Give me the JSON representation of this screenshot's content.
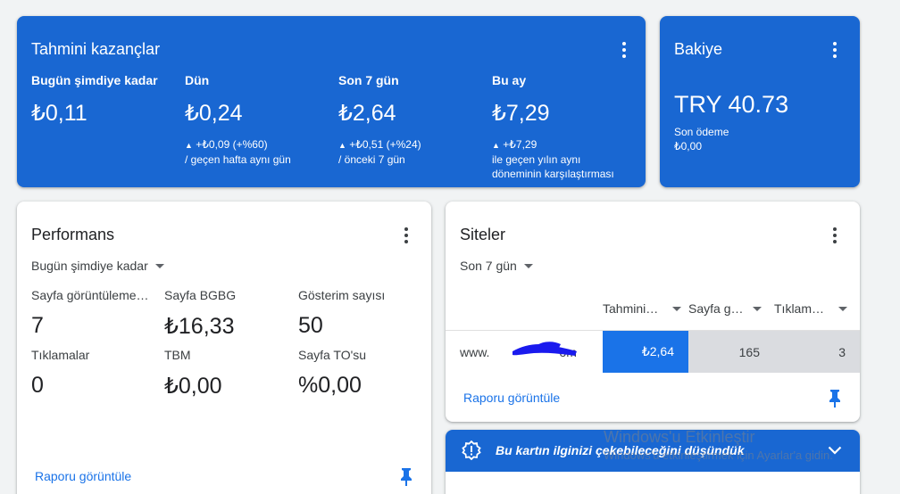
{
  "earnings": {
    "title": "Tahmini kazançlar",
    "metrics": [
      {
        "label": "Bugün şimdiye kadar",
        "value": "₺0,11",
        "delta": "",
        "delta_note": ""
      },
      {
        "label": "Dün",
        "value": "₺0,24",
        "delta": "+₺0,09 (+%60)",
        "delta_note": "/ geçen hafta aynı gün"
      },
      {
        "label": "Son 7 gün",
        "value": "₺2,64",
        "delta": "+₺0,51 (+%24)",
        "delta_note": "/ önceki 7 gün"
      },
      {
        "label": "Bu ay",
        "value": "₺7,29",
        "delta": "+₺7,29",
        "delta_note": "ile geçen yılın aynı",
        "delta_note2": "döneminin karşılaştırması"
      }
    ]
  },
  "balance": {
    "title": "Bakiye",
    "amount": "TRY 40.73",
    "last_label": "Son ödeme",
    "last_value": "₺0,00"
  },
  "performance": {
    "title": "Performans",
    "range": "Bugün şimdiye kadar",
    "stats": [
      {
        "label": "Sayfa görüntüleme…",
        "value": "7"
      },
      {
        "label": "Sayfa BGBG",
        "value": "₺16,33"
      },
      {
        "label": "Gösterim sayısı",
        "value": "50"
      },
      {
        "label": "Tıklamalar",
        "value": "0"
      },
      {
        "label": "TBM",
        "value": "₺0,00"
      },
      {
        "label": "Sayfa TO'su",
        "value": "%0,00"
      }
    ],
    "report_link": "Raporu görüntüle"
  },
  "sites": {
    "title": "Siteler",
    "range": "Son 7 gün",
    "columns": [
      "Tahmini…",
      "Sayfa g…",
      "Tıklama…"
    ],
    "rows": [
      {
        "site_prefix": "www.",
        "site_suffix": "om",
        "earnings": "₺2,64",
        "pageviews": "165",
        "clicks": "3"
      }
    ],
    "report_link": "Raporu görüntüle"
  },
  "banner": {
    "message": "Bu kartın ilginizi çekebileceğini düşündük"
  },
  "watermark": {
    "line1": "Windows'u Etkinleştir",
    "line2": "Windows'u etkinleştirmek için Ayarlar'a gidin."
  },
  "colors": {
    "blue": "#1967d2",
    "link": "#1a73e8",
    "highlight_cell": "#1a73e8",
    "gray_cell": "#dadce0"
  }
}
